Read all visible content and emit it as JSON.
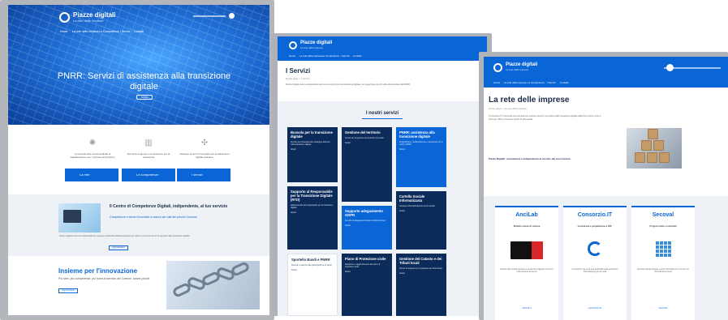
{
  "page1": {
    "brand": "Piazze digitali",
    "tagline": "La rete delle imprese",
    "nav": [
      "Home",
      "La rete delle imprese",
      "Le Competenze",
      "I Servizi",
      "Contatti"
    ],
    "hero_title": "PNRR: Servizi di assistenza alla transizione digitale",
    "hero_button": "Scopri",
    "features": [
      {
        "icon": "gear-icon",
        "text": "La società offre servizi dedicati di digitalizzazione per i Comuni del territorio",
        "button": "La rete"
      },
      {
        "icon": "chart-icon",
        "text": "Servizi di supporto e competenze per la transizione",
        "button": "Le competenze"
      },
      {
        "icon": "network-icon",
        "text": "Sviluppo di servizi innovativi per la transizione digitale dell'ente",
        "button": "I servizi"
      }
    ],
    "cc_title": "Il Centro di Competenze Digitali, indipendente, al tuo servizio",
    "cc_subtitle": "Competenze e servizi innovativi a misura per tutti del piccolo Comune",
    "cc_body": "Piazze digitali unisce le realtà locali che operano nell'ambito dell'innovazione per offrire ai Comuni servizi di supporto alla transizione digitale",
    "cc_button": "Approfondisci",
    "ins_title": "Insieme per l'innovazione",
    "ins_subtitle": "Più idee, più competenze, più forza al servizio dei Comuni, anche piccoli",
    "ins_button": "Approfondisci"
  },
  "page2": {
    "brand": "Piazze digitali",
    "tagline": "La rete delle imprese",
    "nav": [
      "Home",
      "La rete delle imprese",
      "Le Competenze",
      "I Servizi",
      "Contatti"
    ],
    "title": "I Servizi",
    "crumb": "Home page > I Servizi",
    "intro": "Piazze Digitali mette a disposizione dei Comuni servizi per la transizione digitale, per supportare gli enti nelle sfide previste dal PNRR.",
    "grid_title": "I nostri servizi",
    "services": [
      {
        "title": "Bussola per la transizione digitale",
        "text": "Servizio per l'orientamento strategico dell'ente nella transizione digitale",
        "link": "Scopri"
      },
      {
        "title": "Gestione del territorio",
        "text": "Servizi per la gestione del territorio comunale",
        "link": "Scopri"
      },
      {
        "title": "PNRR: assistenza alla transizione digitale",
        "text": "Progettazione, rendicontazione e assistenza per le misure PNRR",
        "link": "Scopri"
      },
      {
        "title": "Supporto al Responsabile per la Transizione Digitale (RTD)",
        "text": "Affiancamento del responsabile per la transizione digitale",
        "link": "Scopri"
      },
      {
        "title": "Supporto adeguamento GDPR",
        "text": "Servizio di adeguamento alla normativa privacy",
        "link": "Scopri"
      },
      {
        "title": "Cartella Sociale Informatizzata",
        "text": "Gestione informatizzata dei servizi sociali",
        "link": "Scopri"
      },
      {
        "title": "Sportello Bandi e PNRR",
        "text": "Ricerca e supporto alla partecipazione ai bandi",
        "link": "Scopri"
      },
      {
        "title": "Piano di Protezione civile",
        "text": "Redazione e aggiornamento del piano di protezione civile",
        "link": "Scopri"
      },
      {
        "title": "Gestione del Catasto e dei Tributi locali",
        "text": "Servizi di supporto per la gestione dei tributi locali",
        "link": "Scopri"
      }
    ]
  },
  "page3": {
    "brand": "Piazze digitali",
    "tagline": "La rete delle imprese",
    "nav": [
      "Home",
      "La rete delle imprese",
      "Le Competenze",
      "I Servizi",
      "Contatti"
    ],
    "title": "La rete delle imprese",
    "crumb": "Home page > La rete delle imprese",
    "body": "Il Consorzio IT e Seconal sono società che operano da anni nel settore dell'innovazione digitale della PA e hanno unito le forze per offrire ai Comuni servizi di alta qualità.",
    "lead": "Piazze Digitali: competenze e indipendenza al servizio dei tuoi Comuni",
    "cards": [
      {
        "name": "AnciLab",
        "subtitle": "Modelli e azioni di sistema",
        "text": "AnciLab offre modelli operativi e strumenti di supporto ai Comuni nella gestione dei servizi",
        "link": "anciLab.it"
      },
      {
        "name": "Consorzio.IT",
        "subtitle": "Consulenza e progettazione a 360°",
        "text": "Consorzio.IT opera da anni nell'ambito della consulenza informatica per gli enti locali",
        "link": "consorzioit.net"
      },
      {
        "name": "Secoval",
        "subtitle": "Progetti solidi e sostenibili",
        "text": "Secoval sviluppa progetti e servizi informatici per i Comuni e le comunità del territorio",
        "link": "secoval.it"
      }
    ]
  },
  "colors": {
    "primary": "#0a66d6",
    "dark_navy": "#0b2b5a",
    "band": "#eef1f5"
  }
}
